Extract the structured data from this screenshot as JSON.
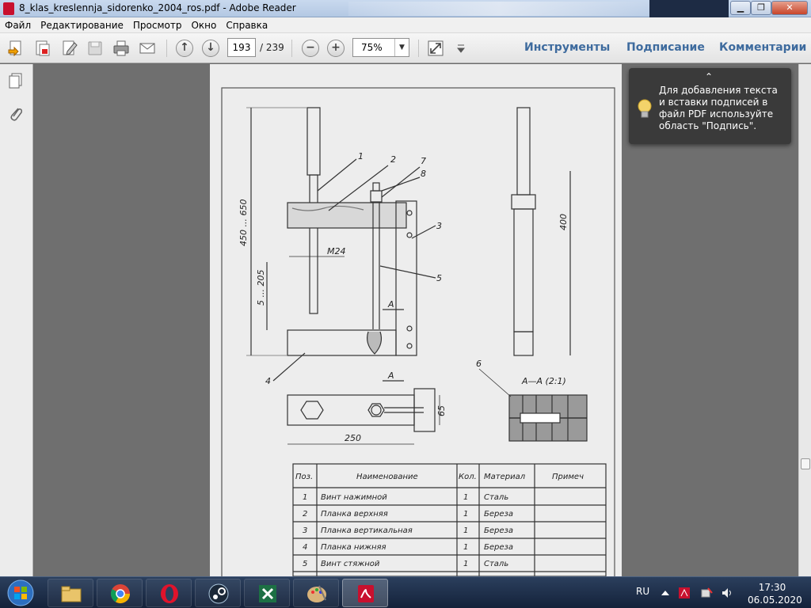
{
  "window": {
    "title": "8_klas_kreslennja_sidorenko_2004_ros.pdf - Adobe Reader"
  },
  "menu": [
    "Файл",
    "Редактирование",
    "Просмотр",
    "Окно",
    "Справка"
  ],
  "toolbar": {
    "page_current": "193",
    "page_total": "/ 239",
    "zoom": "75%"
  },
  "panels": {
    "tools": "Инструменты",
    "sign": "Подписание",
    "comments": "Комментарии"
  },
  "tooltip": {
    "text": "Для добавления текста и вставки подписей в файл PDF используйте область \"Подпись\"."
  },
  "drawing": {
    "leaders": [
      "1",
      "2",
      "3",
      "4",
      "5",
      "6",
      "7",
      "8"
    ],
    "dims": {
      "overall": "450 ... 650",
      "lower": "5 ... 205",
      "right": "400",
      "thread": "M24",
      "base_len": "250",
      "base_w": "65"
    },
    "section_label": "А",
    "section_title": "А—А (2:1)"
  },
  "bom": {
    "headers": [
      "Поз.",
      "Наименование",
      "Кол.",
      "Материал",
      "Примеч"
    ],
    "rows": [
      [
        "1",
        "Винт нажимной",
        "1",
        "Сталь",
        ""
      ],
      [
        "2",
        "Планка верхняя",
        "1",
        "Береза",
        ""
      ],
      [
        "3",
        "Планка вертикальная",
        "1",
        "Береза",
        ""
      ],
      [
        "4",
        "Планка нижняя",
        "1",
        "Береза",
        ""
      ],
      [
        "5",
        "Винт стяжной",
        "1",
        "Сталь",
        ""
      ]
    ]
  },
  "tray": {
    "lang": "RU",
    "time": "17:30",
    "date": "06.05.2020"
  }
}
